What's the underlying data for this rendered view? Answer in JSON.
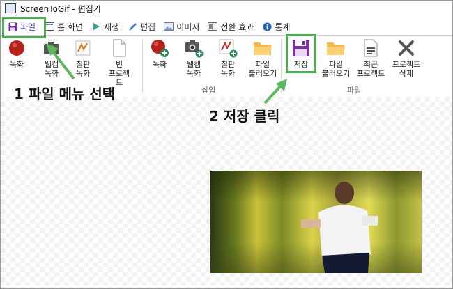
{
  "window": {
    "title": "ScreenToGif - 편집기"
  },
  "tabs": [
    {
      "label": "파일",
      "icon": "save-icon",
      "active": true
    },
    {
      "label": "홈 화면",
      "icon": "home-screen-icon"
    },
    {
      "label": "재생",
      "icon": "play-icon"
    },
    {
      "label": "편집",
      "icon": "pencil-icon"
    },
    {
      "label": "이미지",
      "icon": "image-icon"
    },
    {
      "label": "전환 효과",
      "icon": "transition-icon"
    },
    {
      "label": "통계",
      "icon": "info-icon"
    }
  ],
  "ribbon": {
    "new_group": [
      {
        "label": "녹화",
        "icon": "record-icon"
      },
      {
        "label": "웹캠\n녹화",
        "icon": "webcam-icon"
      },
      {
        "label": "칠판\n녹화",
        "icon": "board-icon"
      },
      {
        "label": "빈\n프로젝트",
        "icon": "blank-project-icon"
      }
    ],
    "insert_group": {
      "label": "삽입",
      "buttons": [
        {
          "label": "녹화",
          "icon": "record-add-icon"
        },
        {
          "label": "웹캠\n녹화",
          "icon": "webcam-add-icon"
        },
        {
          "label": "칠판\n녹화",
          "icon": "board-add-icon"
        },
        {
          "label": "파일\n불러오기",
          "icon": "folder-add-icon"
        }
      ]
    },
    "file_group": {
      "label": "파일",
      "buttons": [
        {
          "label": "저장",
          "icon": "save-icon"
        },
        {
          "label": "파일\n불러오기",
          "icon": "folder-icon"
        },
        {
          "label": "최근\n프로젝트",
          "icon": "recent-projects-icon"
        },
        {
          "label": "프로젝트\n삭제",
          "icon": "delete-icon"
        }
      ]
    }
  },
  "annotations": {
    "step1": "1 파일 메뉴 선택",
    "step2": "2 저장 클릭",
    "highlight_color": "#4caf50"
  }
}
